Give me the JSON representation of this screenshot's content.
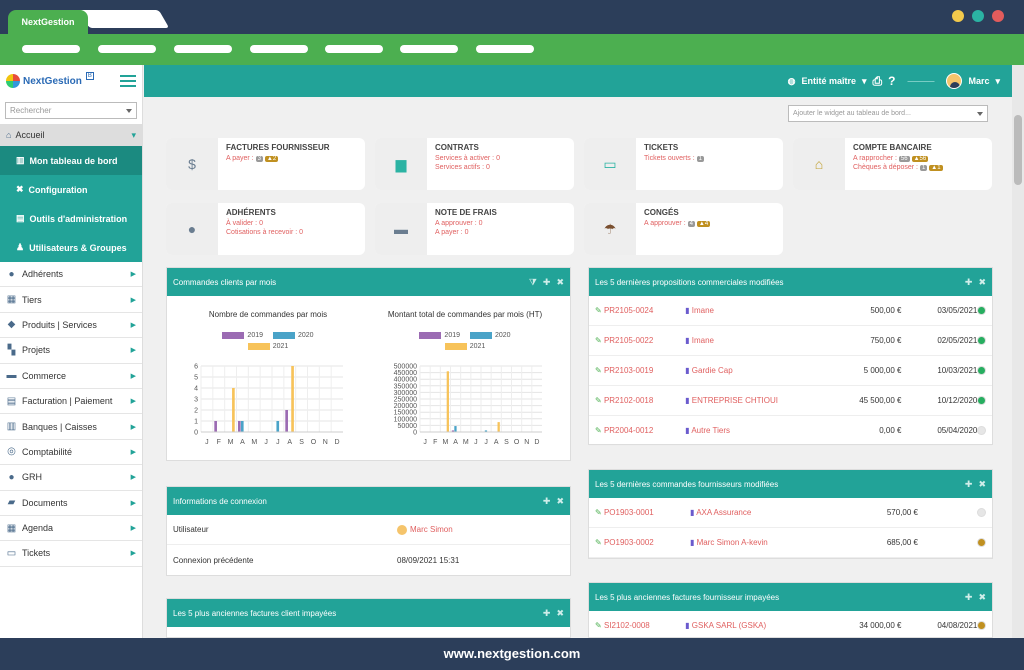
{
  "browser": {
    "tab_title": "NextGestion",
    "footer_url": "www.nextgestion.com",
    "dots": [
      "#f2c94c",
      "#2bb3a3",
      "#e25c5c"
    ]
  },
  "sidebar": {
    "logo": "NextGestion",
    "logo_badge": "B",
    "search_placeholder": "Rechercher",
    "accueil": "Accueil",
    "sub_items": [
      {
        "label": "Mon tableau de bord",
        "icon": "chart-icon"
      },
      {
        "label": "Configuration",
        "icon": "tools-icon"
      },
      {
        "label": "Outils d'administration",
        "icon": "admin-icon"
      },
      {
        "label": "Utilisateurs & Groupes",
        "icon": "users-icon"
      }
    ],
    "items": [
      {
        "label": "Adhérents",
        "glyph": "●"
      },
      {
        "label": "Tiers",
        "glyph": "▦"
      },
      {
        "label": "Produits | Services",
        "glyph": "◆"
      },
      {
        "label": "Projets",
        "glyph": "▚"
      },
      {
        "label": "Commerce",
        "glyph": "▬"
      },
      {
        "label": "Facturation | Paiement",
        "glyph": "▤"
      },
      {
        "label": "Banques | Caisses",
        "glyph": "▥"
      },
      {
        "label": "Comptabilité",
        "glyph": "◎"
      },
      {
        "label": "GRH",
        "glyph": "●"
      },
      {
        "label": "Documents",
        "glyph": "▰"
      },
      {
        "label": "Agenda",
        "glyph": "▦"
      },
      {
        "label": "Tickets",
        "glyph": "▭"
      }
    ]
  },
  "header": {
    "entity": "Entité maître",
    "user": "Marc"
  },
  "widget_select": {
    "placeholder": "Ajouter le widget au tableau de bord..."
  },
  "cards": [
    {
      "title": "FACTURES FOURNISSEUR",
      "icon": "invoice-icon",
      "lines": [
        {
          "text": "A payer :",
          "badges": [
            "3",
            "▲2"
          ]
        }
      ]
    },
    {
      "title": "CONTRATS",
      "icon": "briefcase-icon",
      "lines": [
        {
          "text": "Services à activer : 0",
          "badges": []
        },
        {
          "text": "Services actifs : 0",
          "badges": []
        }
      ]
    },
    {
      "title": "TICKETS",
      "icon": "ticket-icon",
      "lines": [
        {
          "text": "Tickets ouverts :",
          "badges": [
            "1"
          ]
        }
      ]
    },
    {
      "title": "COMPTE BANCAIRE",
      "icon": "bank-icon",
      "lines": [
        {
          "text": "A rapprocher :",
          "badges": [
            "56",
            "▲56"
          ]
        },
        {
          "text": "Chèques à déposer :",
          "badges": [
            "1",
            "▲1"
          ]
        }
      ]
    },
    {
      "title": "ADHÉRENTS",
      "icon": "person-icon",
      "lines": [
        {
          "text": "À valider : 0",
          "badges": []
        },
        {
          "text": "Cotisations à recevoir : 0",
          "badges": []
        }
      ]
    },
    {
      "title": "NOTE DE FRAIS",
      "icon": "wallet-icon",
      "lines": [
        {
          "text": "A approuver : 0",
          "badges": []
        },
        {
          "text": "A payer : 0",
          "badges": []
        }
      ]
    },
    {
      "title": "CONGÉS",
      "icon": "beach-icon",
      "lines": [
        {
          "text": "A approuver :",
          "badges": [
            "4",
            "▲4"
          ]
        }
      ]
    }
  ],
  "orders_panel": {
    "title": "Commandes clients par mois",
    "chart_data": [
      {
        "type": "bar",
        "title": "Nombre de commandes par mois",
        "categories": [
          "J",
          "F",
          "M",
          "A",
          "M",
          "J",
          "J",
          "A",
          "S",
          "O",
          "N",
          "D"
        ],
        "ylim": [
          0,
          6
        ],
        "yticks": [
          0,
          1,
          2,
          3,
          4,
          5,
          6
        ],
        "series": [
          {
            "name": "2019",
            "color": "#9b6bb3",
            "values": [
              0,
              1,
              0,
              1,
              0,
              0,
              0,
              2,
              0,
              0,
              0,
              0
            ]
          },
          {
            "name": "2020",
            "color": "#4aa3c8",
            "values": [
              0,
              0,
              0,
              1,
              0,
              0,
              1,
              0,
              0,
              0,
              0,
              0
            ]
          },
          {
            "name": "2021",
            "color": "#f7c35a",
            "values": [
              0,
              0,
              4,
              0,
              0,
              0,
              0,
              6,
              0,
              0,
              0,
              0
            ]
          }
        ]
      },
      {
        "type": "bar",
        "title": "Montant total de commandes par mois (HT)",
        "categories": [
          "J",
          "F",
          "M",
          "A",
          "M",
          "J",
          "J",
          "A",
          "S",
          "O",
          "N",
          "D"
        ],
        "ylim": [
          0,
          500000
        ],
        "yticks": [
          0,
          50000,
          100000,
          150000,
          200000,
          250000,
          300000,
          350000,
          400000,
          450000,
          500000
        ],
        "series": [
          {
            "name": "2019",
            "color": "#9b6bb3",
            "values": [
              0,
              2000,
              0,
              12000,
              0,
              0,
              0,
              3000,
              0,
              0,
              0,
              0
            ]
          },
          {
            "name": "2020",
            "color": "#4aa3c8",
            "values": [
              0,
              0,
              0,
              45000,
              0,
              0,
              12000,
              0,
              0,
              0,
              0,
              0
            ]
          },
          {
            "name": "2021",
            "color": "#f7c35a",
            "values": [
              0,
              0,
              460000,
              0,
              0,
              0,
              0,
              75000,
              0,
              0,
              0,
              0
            ]
          }
        ]
      }
    ]
  },
  "login_panel": {
    "title": "Informations de connexion",
    "rows": [
      {
        "label": "Utilisateur",
        "value": "Marc Simon"
      },
      {
        "label": "Connexion précédente",
        "value": "08/09/2021 15:31"
      }
    ]
  },
  "unpaid_client_panel": {
    "title": "Les 5 plus anciennes factures client impayées"
  },
  "proposals_panel": {
    "title": "Les 5 dernières propositions commerciales modifiées",
    "rows": [
      {
        "ref": "PR2105-0024",
        "name": "Imane",
        "amount": "500,00 €",
        "date": "03/05/2021",
        "status": "#27ae60"
      },
      {
        "ref": "PR2105-0022",
        "name": "Imane",
        "amount": "750,00 €",
        "date": "02/05/2021",
        "status": "#27ae60"
      },
      {
        "ref": "PR2103-0019",
        "name": "Gardie Cap",
        "amount": "5 000,00 €",
        "date": "10/03/2021",
        "status": "#27ae60"
      },
      {
        "ref": "PR2102-0018",
        "name": "ENTREPRISE CHTIOUI",
        "amount": "45 500,00 €",
        "date": "10/12/2020",
        "status": "#27ae60"
      },
      {
        "ref": "PR2004-0012",
        "name": "Autre Tiers",
        "amount": "0,00 €",
        "date": "05/04/2020",
        "status": "#e6e6e6"
      }
    ]
  },
  "supplier_orders_panel": {
    "title": "Les 5 dernières commandes fournisseurs modifiées",
    "rows": [
      {
        "ref": "PO1903-0001",
        "name": "AXA Assurance",
        "amount": "570,00 €",
        "status": "#e6e6e6"
      },
      {
        "ref": "PO1903-0002",
        "name": "Marc Simon A-kevin",
        "amount": "685,00 €",
        "status": "#c09020"
      }
    ]
  },
  "unpaid_supplier_panel": {
    "title": "Les 5 plus anciennes factures fournisseur impayées",
    "rows": [
      {
        "ref": "SI2102-0008",
        "name": "GSKA SARL (GSKA)",
        "amount": "34 000,00 €",
        "date": "04/08/2021",
        "status": "#c09020"
      }
    ]
  }
}
